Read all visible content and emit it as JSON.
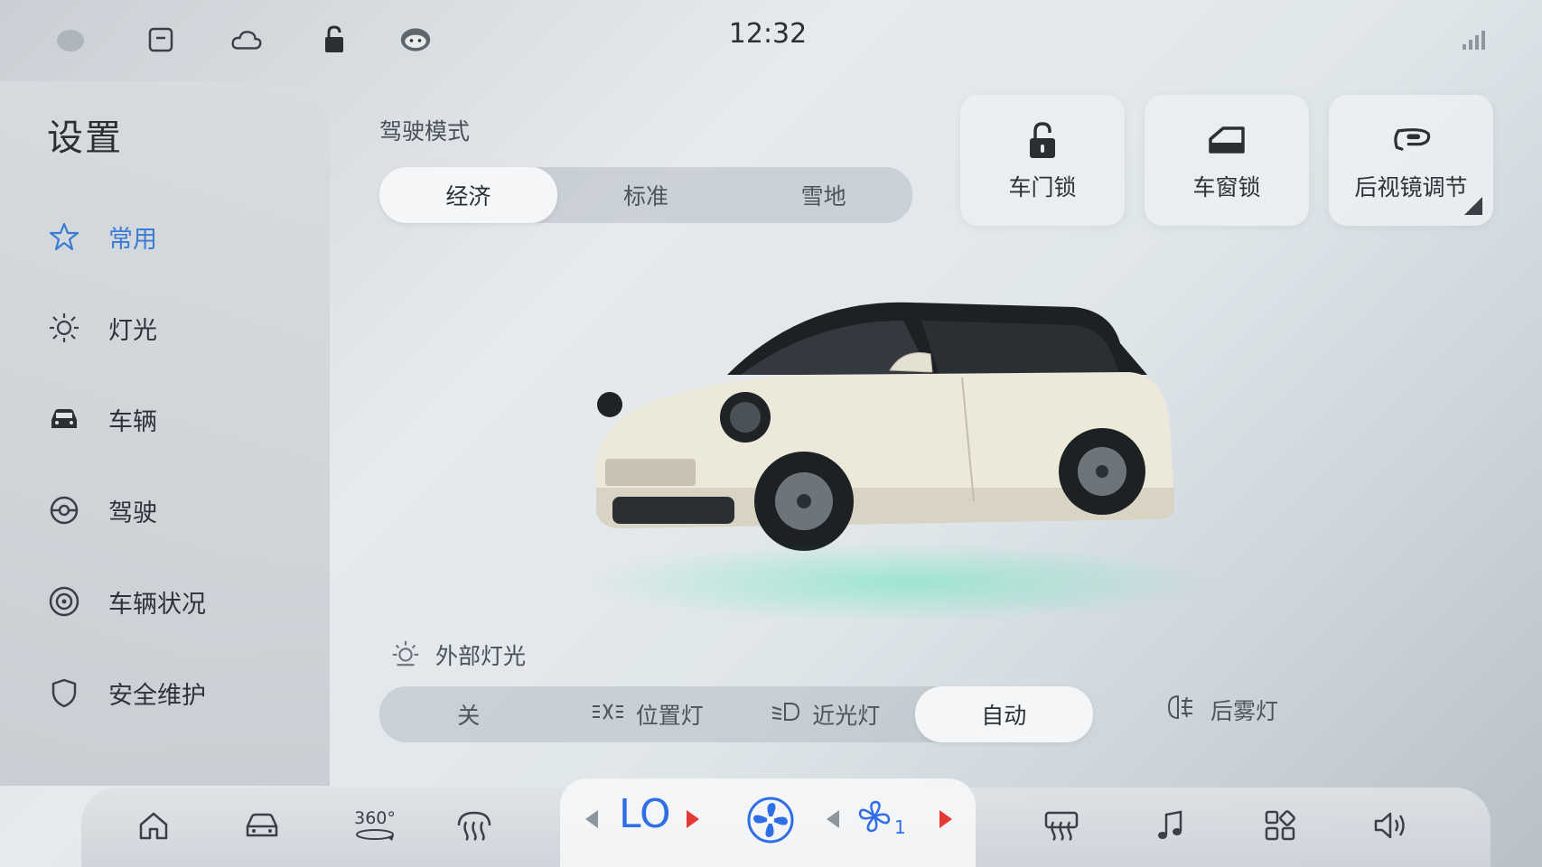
{
  "status_bar": {
    "time": "12:32",
    "icons": [
      "profile-icon",
      "storage-icon",
      "cloud-icon",
      "lock-icon",
      "assistant-icon",
      "signal-icon"
    ]
  },
  "sidebar": {
    "title": "设置",
    "items": [
      {
        "label": "常用",
        "icon": "star-icon",
        "active": true
      },
      {
        "label": "灯光",
        "icon": "light-icon",
        "active": false
      },
      {
        "label": "车辆",
        "icon": "car-icon",
        "active": false
      },
      {
        "label": "驾驶",
        "icon": "steering-wheel-icon",
        "active": false
      },
      {
        "label": "车辆状况",
        "icon": "vehicle-status-icon",
        "active": false
      },
      {
        "label": "安全维护",
        "icon": "shield-icon",
        "active": false
      }
    ]
  },
  "drive_mode": {
    "label": "驾驶模式",
    "options": [
      "经济",
      "标准",
      "雪地"
    ],
    "selected": "经济"
  },
  "quick_controls": [
    {
      "label": "车门锁",
      "icon": "door-lock-icon"
    },
    {
      "label": "车窗锁",
      "icon": "window-lock-icon"
    },
    {
      "label": "后视镜调节",
      "icon": "mirror-adjust-icon"
    }
  ],
  "exterior_lights": {
    "label": "外部灯光",
    "options": [
      "关",
      "位置灯",
      "近光灯",
      "自动"
    ],
    "selected": "自动",
    "rear_fog_label": "后雾灯"
  },
  "dock": {
    "temperature": "LO",
    "fan_speed": "1",
    "view_360_label": "360°",
    "items": [
      "home-icon",
      "car-icon",
      "360-view-icon",
      "front-defrost-icon",
      "rear-defrost-icon",
      "music-icon",
      "apps-icon",
      "volume-icon"
    ]
  },
  "colors": {
    "accent": "#3a7bd5",
    "temp_blue": "#2f6ee6",
    "arrow_red": "#e53935"
  }
}
